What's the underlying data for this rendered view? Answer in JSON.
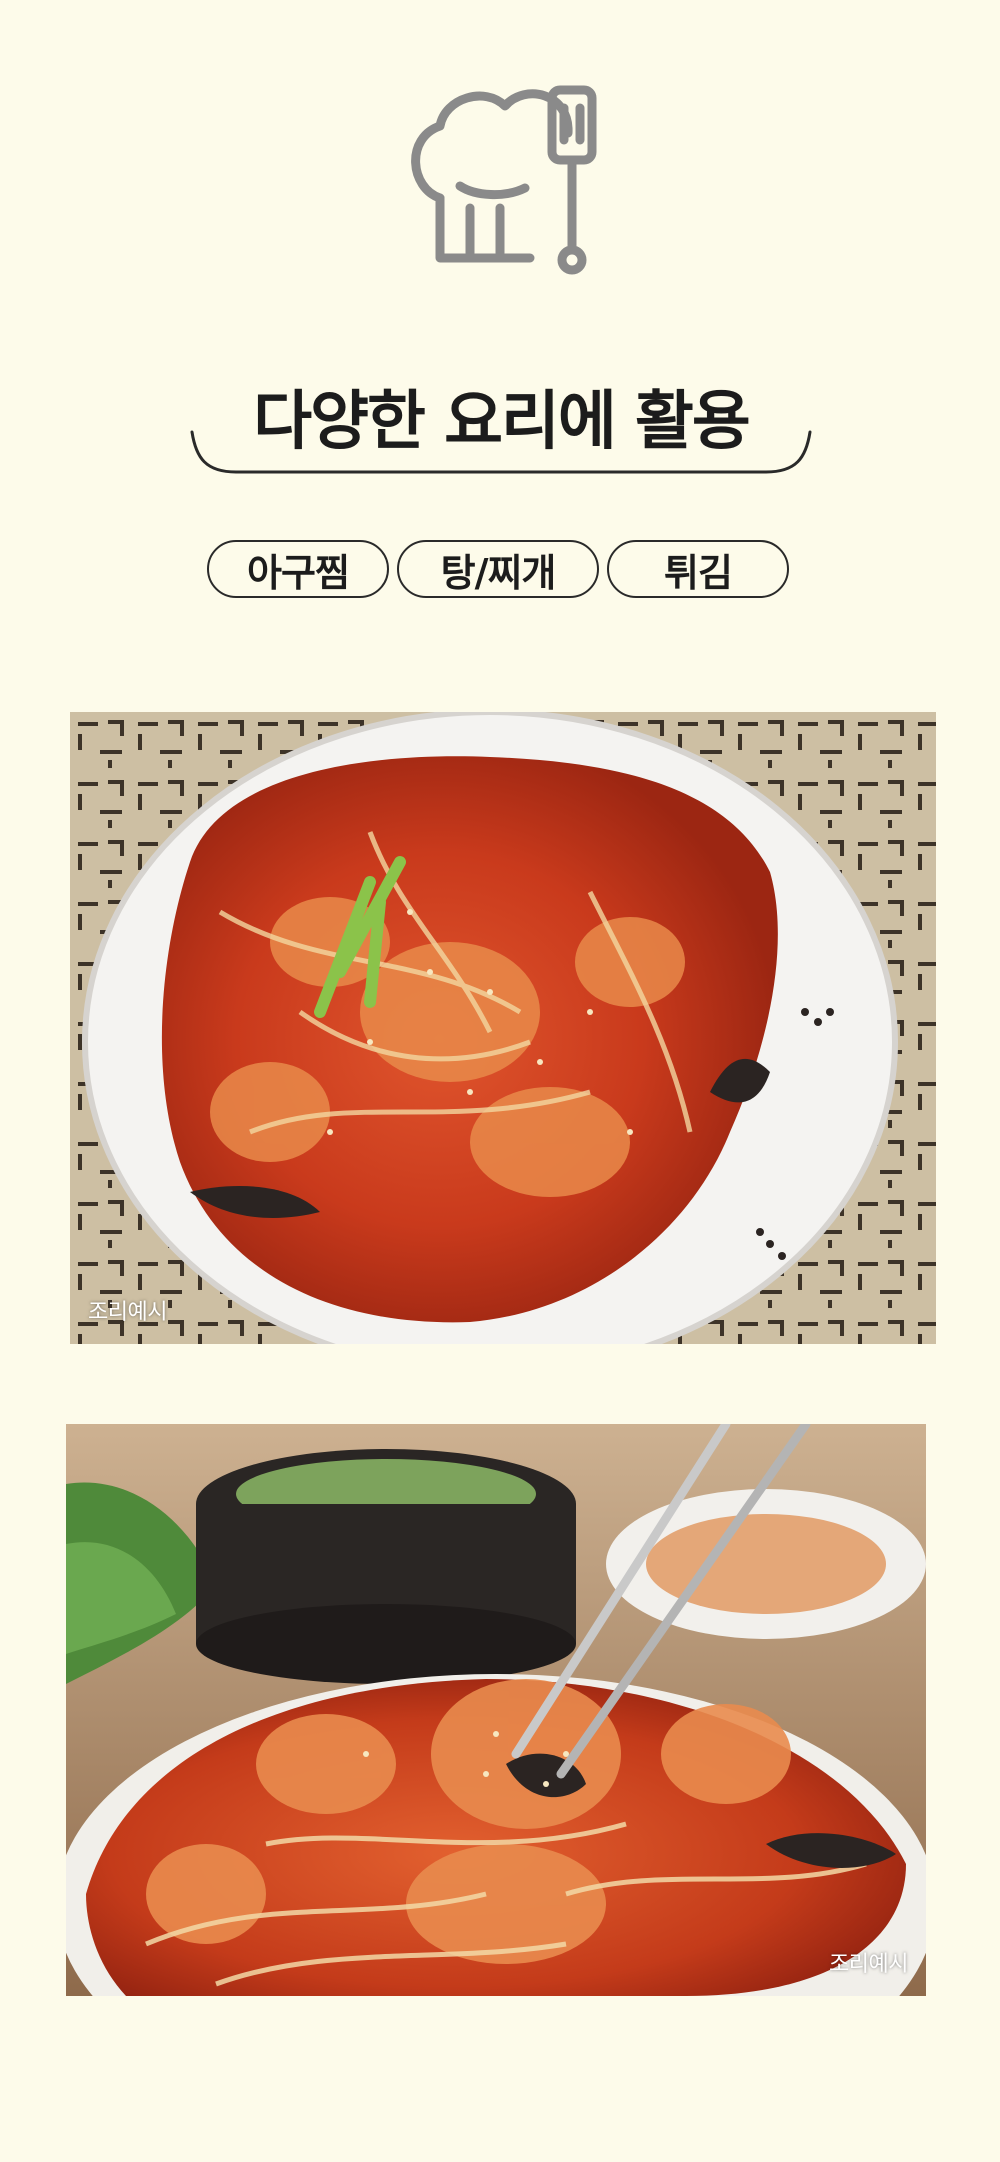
{
  "header": {
    "icon": "chef-hat-spatula-icon",
    "title": "다양한 요리에 활용"
  },
  "tags": [
    {
      "label": "아구찜"
    },
    {
      "label": "탕/찌개"
    },
    {
      "label": "튀김"
    }
  ],
  "photos": [
    {
      "caption": "조리예시",
      "subject": "braised-monkfish-plate"
    },
    {
      "caption": "조리예시",
      "subject": "monkfish-with-chopsticks"
    }
  ],
  "colors": {
    "background": "#fdfbea",
    "icon_stroke": "#8a8a8a",
    "text": "#1c1c1c"
  }
}
